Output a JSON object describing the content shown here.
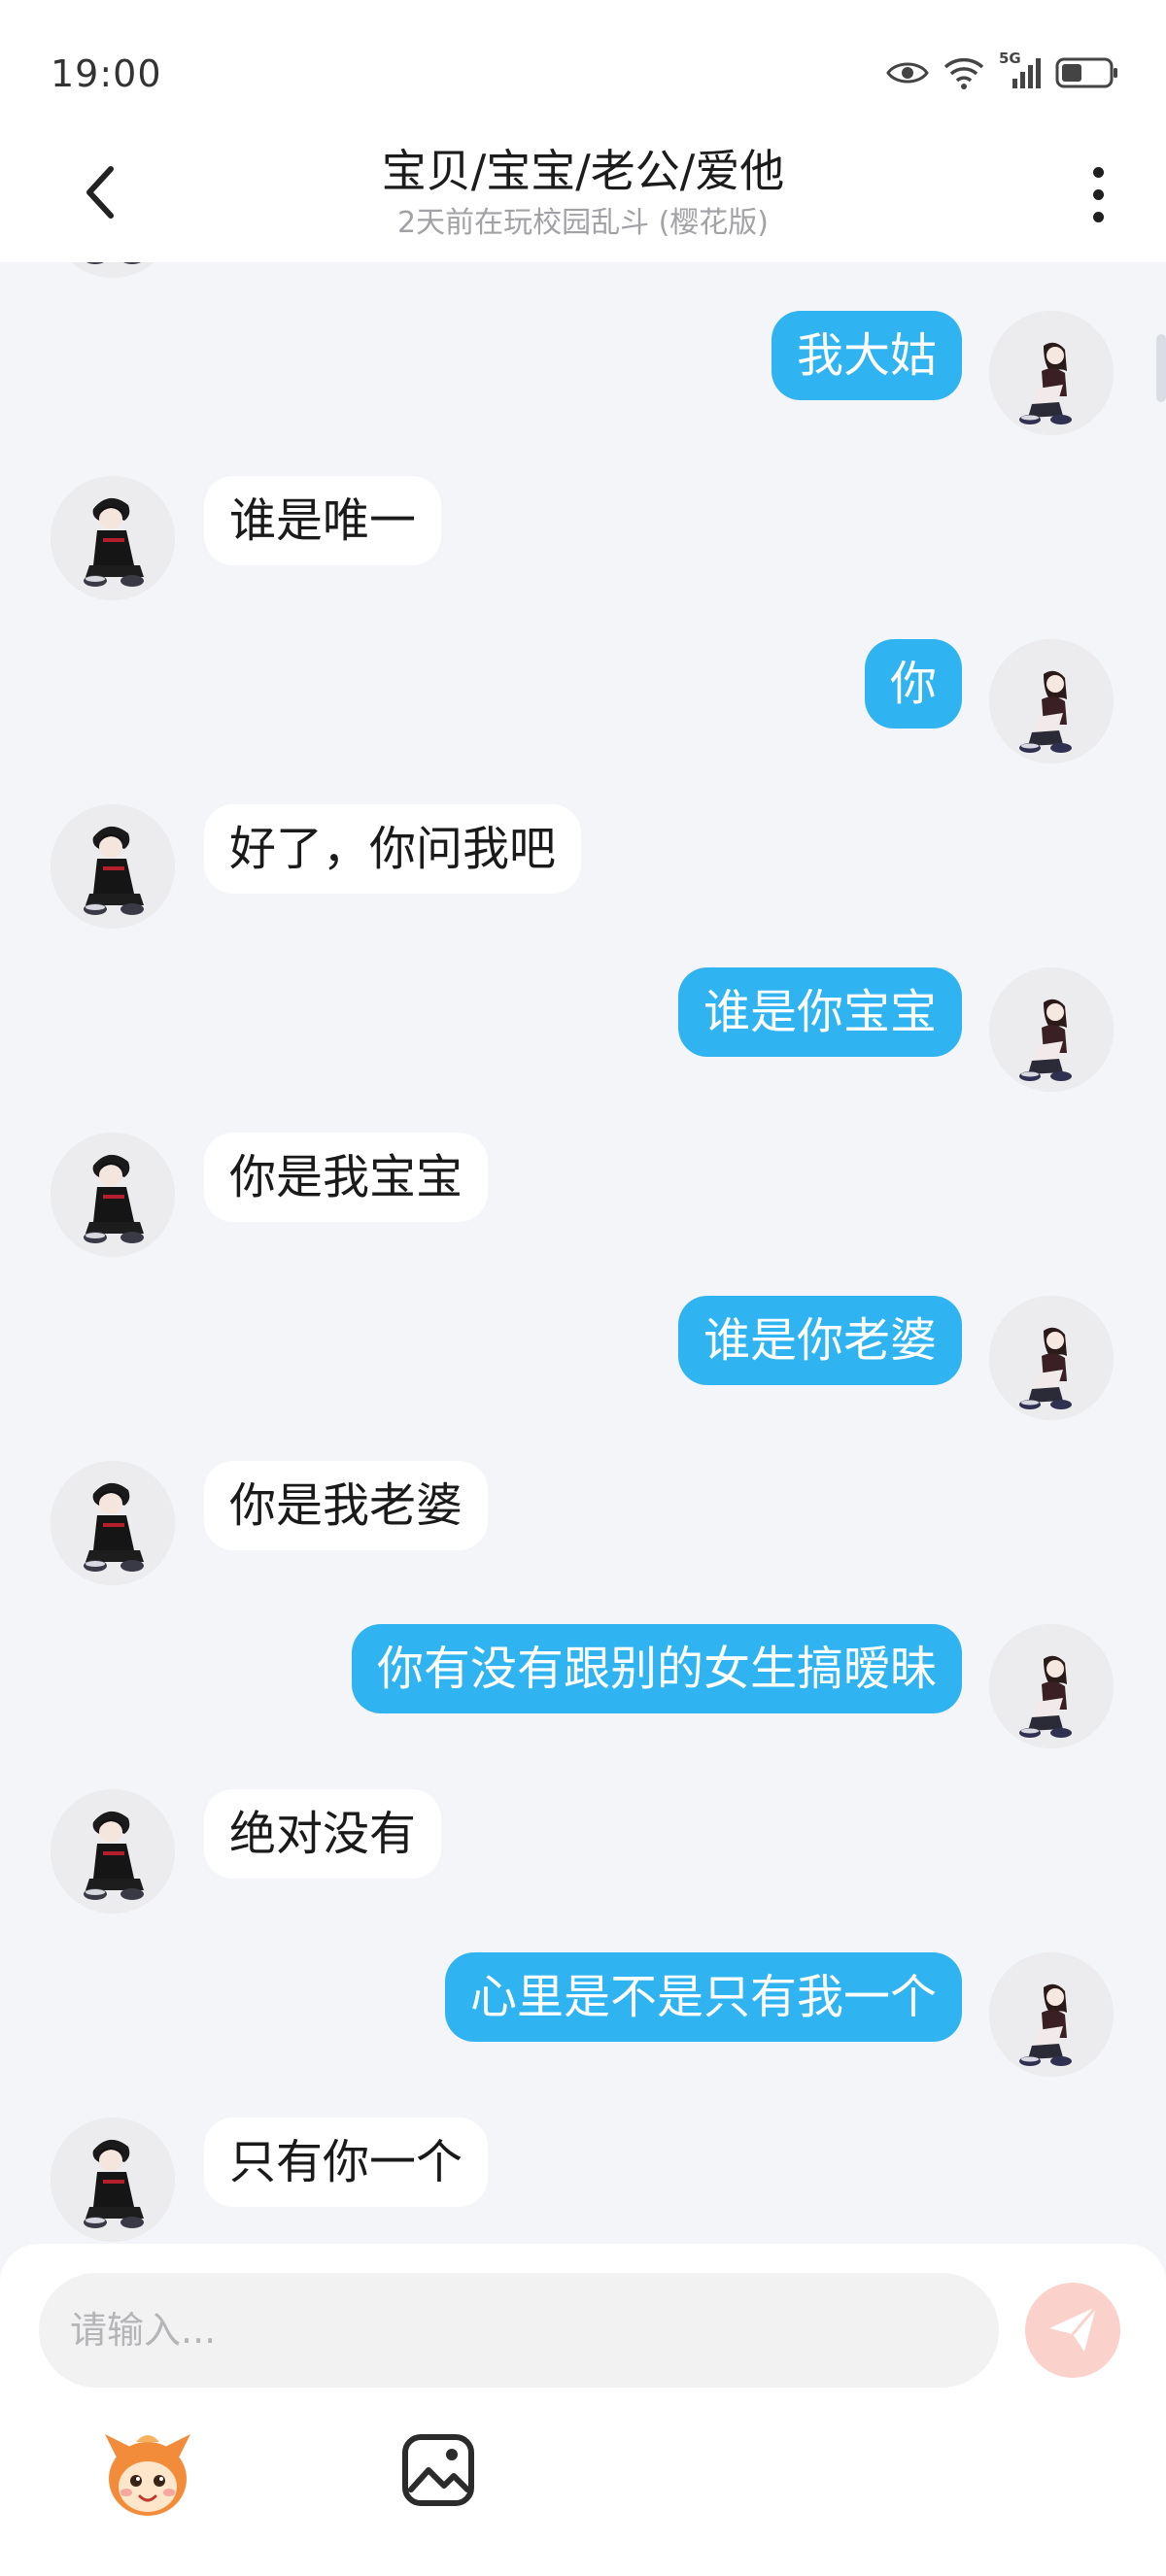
{
  "status_bar": {
    "time": "19:00",
    "icons": [
      "eye-icon",
      "wifi-icon",
      "signal-5g-icon",
      "battery-icon"
    ],
    "network_label": "5G"
  },
  "header": {
    "title": "宝贝/宝宝/老公/爱他",
    "subtitle": "2天前在玩校园乱斗 (樱花版)",
    "back_icon": "chevron-left-icon",
    "menu_icon": "more-vertical-icon"
  },
  "messages": [
    {
      "from": "me",
      "text": "我大姑"
    },
    {
      "from": "other",
      "text": "谁是唯一"
    },
    {
      "from": "me",
      "text": "你"
    },
    {
      "from": "other",
      "text": "好了，你问我吧"
    },
    {
      "from": "me",
      "text": "谁是你宝宝"
    },
    {
      "from": "other",
      "text": "你是我宝宝"
    },
    {
      "from": "me",
      "text": "谁是你老婆"
    },
    {
      "from": "other",
      "text": "你是我老婆"
    },
    {
      "from": "me",
      "text": "你有没有跟别的女生搞暧昧"
    },
    {
      "from": "other",
      "text": "绝对没有"
    },
    {
      "from": "me",
      "text": "心里是不是只有我一个"
    },
    {
      "from": "other",
      "text": "只有你一个"
    }
  ],
  "input": {
    "placeholder": "请输入...",
    "value": ""
  },
  "toolbar": {
    "send_icon": "send-icon",
    "emoji_icon": "mascot-sticker-icon",
    "image_icon": "image-icon"
  },
  "colors": {
    "my_bubble": "#2fb3f1",
    "other_bubble": "#ffffff",
    "background": "#f3f5f9",
    "send_button": "#fbd1cb"
  }
}
